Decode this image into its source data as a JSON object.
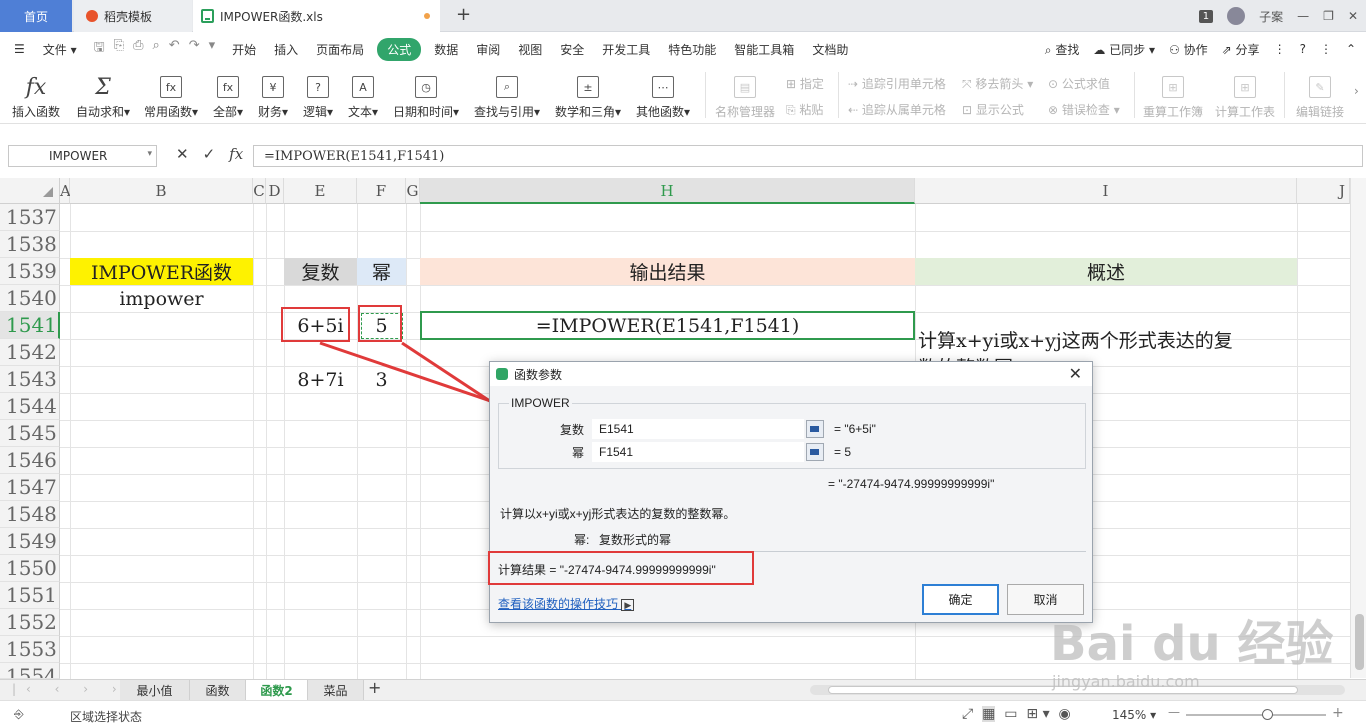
{
  "titlebar": {
    "tabs": [
      {
        "label": "首页"
      },
      {
        "label": "稻壳模板"
      },
      {
        "label": "IMPOWER函数.xls"
      }
    ],
    "window_badge": "1",
    "user_name": "子案"
  },
  "menubar": {
    "file": "文件",
    "items": [
      "开始",
      "插入",
      "页面布局",
      "公式",
      "数据",
      "审阅",
      "视图",
      "安全",
      "开发工具",
      "特色功能",
      "智能工具箱",
      "文档助"
    ],
    "active": "公式",
    "search": "查找",
    "synced": "已同步",
    "collab": "协作",
    "share": "分享"
  },
  "ribbon": {
    "buttons": [
      {
        "label": "插入函数",
        "icon": "fx"
      },
      {
        "label": "自动求和",
        "icon": "Σ"
      },
      {
        "label": "常用函数",
        "icon": "fx"
      },
      {
        "label": "全部",
        "icon": "fx"
      },
      {
        "label": "财务",
        "icon": "¥"
      },
      {
        "label": "逻辑",
        "icon": "?"
      },
      {
        "label": "文本",
        "icon": "A"
      },
      {
        "label": "日期和时间",
        "icon": "◷"
      },
      {
        "label": "查找与引用",
        "icon": "⌕"
      },
      {
        "label": "数学和三角",
        "icon": "±"
      },
      {
        "label": "其他函数",
        "icon": "⋯"
      }
    ],
    "disabled": {
      "name_manager": "名称管理器",
      "assign": "指定",
      "paste": "粘贴",
      "trace_precedents": "追踪引用单元格",
      "trace_dependents": "追踪从属单元格",
      "remove_arrows": "移去箭头",
      "show_formulas": "显示公式",
      "evaluate": "公式求值",
      "error_check": "错误检查",
      "recalc_workbook": "重算工作簿",
      "calc_sheet": "计算工作表",
      "edit_links": "编辑链接"
    }
  },
  "formula_bar": {
    "name_box": "IMPOWER",
    "formula": "=IMPOWER(E1541,F1541)"
  },
  "grid": {
    "columns": [
      "A",
      "B",
      "C",
      "D",
      "E",
      "F",
      "G",
      "H",
      "I",
      "J"
    ],
    "rows": [
      "1537",
      "1538",
      "1539",
      "1540",
      "1541",
      "1542",
      "1543",
      "1544",
      "1545",
      "1546",
      "1547",
      "1548",
      "1549",
      "1550",
      "1551",
      "1552",
      "1553",
      "1554"
    ],
    "cells": {
      "b1539": "IMPOWER函数",
      "b1540": "impower",
      "e1539": "复数",
      "f1539": "幂",
      "h1539": "输出结果",
      "i1539": "概述",
      "e1541": "6+5i",
      "f1541": "5",
      "h1541": "=IMPOWER(E1541,F1541)",
      "i1541": "计算x+yi或x+yj这两个形式表达的复",
      "i1542": "数的整数幂",
      "e1543": "8+7i",
      "f1543": "3"
    },
    "colors": {
      "yellow": "#fef200",
      "gray": "#d9d9d9",
      "lightblue": "#dde9f7",
      "peach": "#fde4d8",
      "lightgreen": "#e2efda"
    }
  },
  "dialog": {
    "title": "函数参数",
    "function_name": "IMPOWER",
    "args": [
      {
        "label": "复数",
        "input": "E1541",
        "value": "\"6+5i\""
      },
      {
        "label": "幂",
        "input": "F1541",
        "value": "5"
      }
    ],
    "result_preview": "\"-27474-9474.99999999999i\"",
    "description": "计算以x+yi或x+yj形式表达的复数的整数幂。",
    "param_name": "幂:",
    "param_desc": "复数形式的幂",
    "calc_result_label": "计算结果",
    "calc_result_eq": "=",
    "calc_result_value": "\"-27474-9474.99999999999i\"",
    "help_link": "查看该函数的操作技巧",
    "ok": "确定",
    "cancel": "取消"
  },
  "sheets": {
    "tabs": [
      "最小值",
      "函数",
      "函数2",
      "菜品"
    ],
    "active": "函数2"
  },
  "statusbar": {
    "mode": "区域选择状态",
    "zoom": "145%"
  },
  "watermark": {
    "main": "Bai du 经验",
    "sub": "jingyan.baidu.com"
  }
}
